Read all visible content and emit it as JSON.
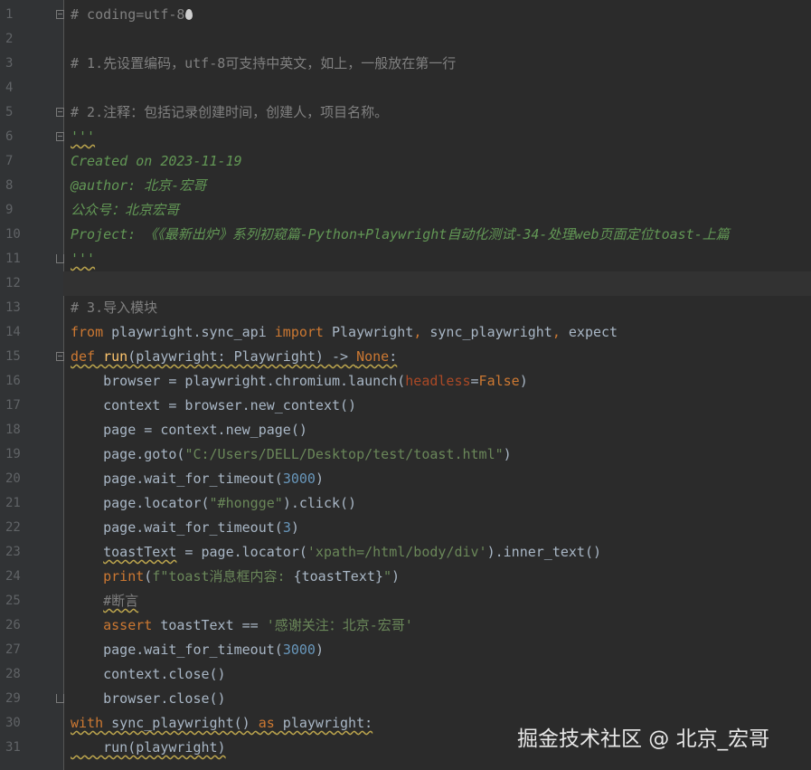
{
  "editor": {
    "lines": [
      {
        "n": "1",
        "tokens": [
          {
            "t": "# coding=utf-8",
            "c": "c-comment"
          }
        ],
        "drop_icon": "drop-icon"
      },
      {
        "n": "2",
        "tokens": []
      },
      {
        "n": "3",
        "tokens": [
          {
            "t": "# 1.先设置编码，utf-8可支持中英文，如上，一般放在第一行",
            "c": "c-comment"
          }
        ]
      },
      {
        "n": "4",
        "tokens": []
      },
      {
        "n": "5",
        "tokens": [
          {
            "t": "# 2.注释：包括记录创建时间，创建人，项目名称。",
            "c": "c-comment"
          }
        ]
      },
      {
        "n": "6",
        "tokens": [
          {
            "t": "'''",
            "c": "c-doc wavy"
          }
        ]
      },
      {
        "n": "7",
        "tokens": [
          {
            "t": "Created on 2023-11-19",
            "c": "c-doc"
          }
        ]
      },
      {
        "n": "8",
        "tokens": [
          {
            "t": "@author: 北京-宏哥",
            "c": "c-doc"
          }
        ]
      },
      {
        "n": "9",
        "tokens": [
          {
            "t": "公众号：北京宏哥",
            "c": "c-doc"
          }
        ]
      },
      {
        "n": "10",
        "tokens": [
          {
            "t": "Project: 《《最新出炉》系列初窥篇-Python+Playwright自动化测试-34-处理web页面定位toast-上篇",
            "c": "c-doc"
          }
        ]
      },
      {
        "n": "11",
        "tokens": [
          {
            "t": "'''",
            "c": "c-doc wavy"
          }
        ]
      },
      {
        "n": "12",
        "tokens": []
      },
      {
        "n": "13",
        "tokens": [
          {
            "t": "# 3.导入模块",
            "c": "c-comment"
          }
        ]
      },
      {
        "n": "14",
        "tokens": [
          {
            "t": "from",
            "c": "c-kw"
          },
          {
            "t": " playwright.sync_api ",
            "c": "c-plain"
          },
          {
            "t": "import",
            "c": "c-kw"
          },
          {
            "t": " Playwright",
            "c": "c-plain"
          },
          {
            "t": ", ",
            "c": "c-kw"
          },
          {
            "t": "sync_playwright",
            "c": "c-plain"
          },
          {
            "t": ", ",
            "c": "c-kw"
          },
          {
            "t": "expect",
            "c": "c-plain"
          }
        ]
      },
      {
        "n": "15",
        "tokens": [
          {
            "t": "def",
            "c": "c-kw wavy"
          },
          {
            "t": " ",
            "c": "c-plain wavy"
          },
          {
            "t": "run",
            "c": "c-def wavy"
          },
          {
            "t": "(playwright: Playwright) -> ",
            "c": "c-plain wavy"
          },
          {
            "t": "None",
            "c": "c-kw wavy"
          },
          {
            "t": ":",
            "c": "c-plain wavy"
          }
        ]
      },
      {
        "n": "16",
        "tokens": [
          {
            "t": "    browser = playwright.chromium.launch(",
            "c": "c-plain"
          },
          {
            "t": "headless",
            "c": "c-param"
          },
          {
            "t": "=",
            "c": "c-plain"
          },
          {
            "t": "False",
            "c": "c-kw"
          },
          {
            "t": ")",
            "c": "c-plain"
          }
        ]
      },
      {
        "n": "17",
        "tokens": [
          {
            "t": "    context = browser.new_context()",
            "c": "c-plain"
          }
        ]
      },
      {
        "n": "18",
        "tokens": [
          {
            "t": "    page = context.new_page()",
            "c": "c-plain"
          }
        ]
      },
      {
        "n": "19",
        "tokens": [
          {
            "t": "    page.goto(",
            "c": "c-plain"
          },
          {
            "t": "\"C:/Users/DELL/Desktop/test/toast.html\"",
            "c": "c-str"
          },
          {
            "t": ")",
            "c": "c-plain"
          }
        ]
      },
      {
        "n": "20",
        "tokens": [
          {
            "t": "    page.wait_for_timeout(",
            "c": "c-plain"
          },
          {
            "t": "3000",
            "c": "c-num"
          },
          {
            "t": ")",
            "c": "c-plain"
          }
        ]
      },
      {
        "n": "21",
        "tokens": [
          {
            "t": "    page.locator(",
            "c": "c-plain"
          },
          {
            "t": "\"#hongge\"",
            "c": "c-str"
          },
          {
            "t": ").click()",
            "c": "c-plain"
          }
        ]
      },
      {
        "n": "22",
        "tokens": [
          {
            "t": "    page.wait_for_timeout(",
            "c": "c-plain"
          },
          {
            "t": "3",
            "c": "c-num"
          },
          {
            "t": ")",
            "c": "c-plain"
          }
        ]
      },
      {
        "n": "23",
        "tokens": [
          {
            "t": "    ",
            "c": "c-plain"
          },
          {
            "t": "toastText",
            "c": "c-plain wavy"
          },
          {
            "t": " = page.locator(",
            "c": "c-plain"
          },
          {
            "t": "'xpath=/html/body/div'",
            "c": "c-str"
          },
          {
            "t": ").inner_text()",
            "c": "c-plain"
          }
        ]
      },
      {
        "n": "24",
        "tokens": [
          {
            "t": "    ",
            "c": "c-plain"
          },
          {
            "t": "print",
            "c": "c-kw"
          },
          {
            "t": "(",
            "c": "c-plain"
          },
          {
            "t": "f\"toast消息框内容: ",
            "c": "c-str"
          },
          {
            "t": "{toastText}",
            "c": "c-plain"
          },
          {
            "t": "\"",
            "c": "c-str"
          },
          {
            "t": ")",
            "c": "c-plain"
          }
        ]
      },
      {
        "n": "25",
        "tokens": [
          {
            "t": "    ",
            "c": "c-plain"
          },
          {
            "t": "#断言",
            "c": "c-comment wavy"
          }
        ]
      },
      {
        "n": "26",
        "tokens": [
          {
            "t": "    ",
            "c": "c-plain"
          },
          {
            "t": "assert",
            "c": "c-kw"
          },
          {
            "t": " toastText == ",
            "c": "c-plain"
          },
          {
            "t": "'感谢关注：北京-宏哥'",
            "c": "c-str"
          }
        ]
      },
      {
        "n": "27",
        "tokens": [
          {
            "t": "    page.wait_for_timeout(",
            "c": "c-plain"
          },
          {
            "t": "3000",
            "c": "c-num"
          },
          {
            "t": ")",
            "c": "c-plain"
          }
        ]
      },
      {
        "n": "28",
        "tokens": [
          {
            "t": "    context.close()",
            "c": "c-plain"
          }
        ]
      },
      {
        "n": "29",
        "tokens": [
          {
            "t": "    browser.close()",
            "c": "c-plain"
          }
        ]
      },
      {
        "n": "30",
        "tokens": [
          {
            "t": "with",
            "c": "c-kw wavy"
          },
          {
            "t": " sync_playwright() ",
            "c": "c-plain wavy"
          },
          {
            "t": "as",
            "c": "c-kw wavy"
          },
          {
            "t": " playwright:",
            "c": "c-plain wavy"
          }
        ]
      },
      {
        "n": "31",
        "tokens": [
          {
            "t": "    run(playwright)",
            "c": "c-plain wavy"
          }
        ]
      }
    ],
    "current_line": "12"
  },
  "watermark": "掘金技术社区 @ 北京_宏哥"
}
